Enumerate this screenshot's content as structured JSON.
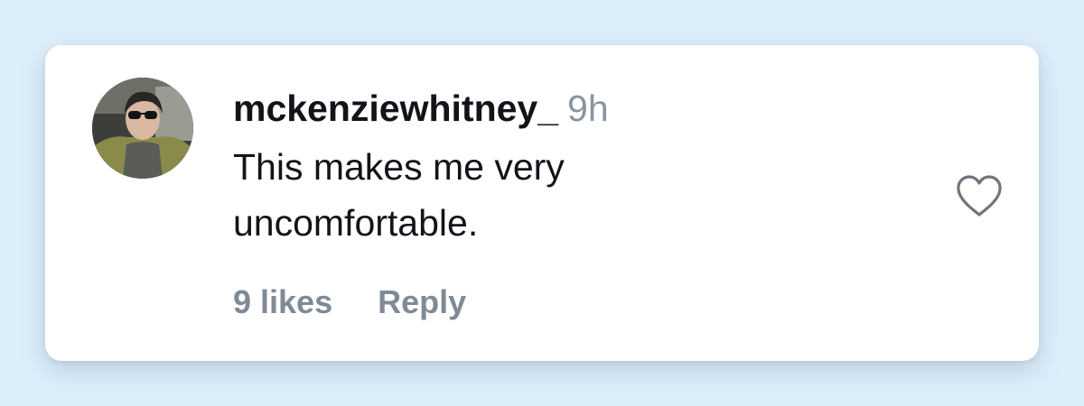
{
  "comment": {
    "username": "mckenziewhitney_",
    "timestamp": "9h",
    "text": "This makes me very uncomfortable.",
    "likes_label": "9 likes",
    "reply_label": "Reply",
    "like_icon": "heart-outline-icon"
  },
  "colors": {
    "page_background": "#ddeefb",
    "card_background": "#ffffff",
    "text_primary": "#111418",
    "text_secondary": "#808a96"
  }
}
